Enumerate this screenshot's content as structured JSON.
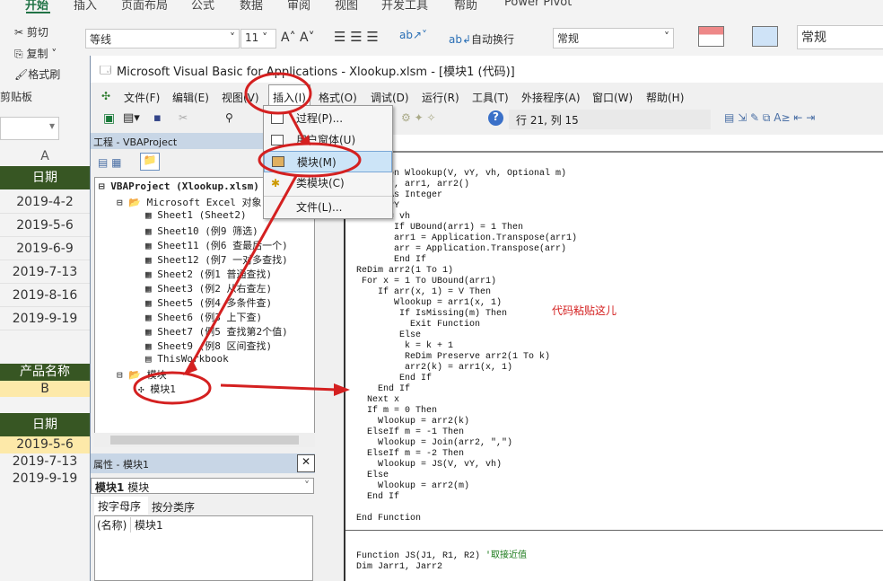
{
  "ribbon": {
    "tabs": [
      "开始",
      "插入",
      "页面布局",
      "公式",
      "数据",
      "审阅",
      "视图",
      "开发工具",
      "帮助",
      "Power Pivot"
    ],
    "cut": "剪切",
    "copy": "复制",
    "format_painter": "格式刷",
    "clipboard_group": "剪贴板",
    "font_name": "等线",
    "font_size": "11",
    "wrap_text": "自动换行",
    "number_format": "常规",
    "style_box": "常规"
  },
  "sheet": {
    "col": "A",
    "header1": "日期",
    "dates1": [
      "2019-4-2",
      "2019-5-6",
      "2019-6-9",
      "2019-7-13",
      "2019-8-16",
      "2019-9-19"
    ],
    "header2": "产品名称",
    "product": "B",
    "header3": "日期",
    "dates2": [
      "2019-5-6",
      "2019-7-13",
      "2019-9-19"
    ]
  },
  "vba": {
    "title": "Microsoft Visual Basic for Applications - Xlookup.xlsm - [模块1 (代码)]",
    "menu": [
      "文件(F)",
      "编辑(E)",
      "视图(V)",
      "插入(I)",
      "格式(O)",
      "调试(D)",
      "运行(R)",
      "工具(T)",
      "外接程序(A)",
      "窗口(W)",
      "帮助(H)"
    ],
    "position": "行 21, 列 15",
    "project_title": "工程 - VBAProject",
    "tree": [
      "VBAProject (Xlookup.xlsm)",
      "Microsoft Excel 对象",
      "Sheet1 (Sheet2)",
      "Sheet10 (例9 筛选)",
      "Sheet11 (例6 查最后一个)",
      "Sheet12 (例7 一对多查找)",
      "Sheet2 (例1 普通查找)",
      "Sheet3 (例2 从右查左)",
      "Sheet5 (例4 多条件查)",
      "Sheet6 (例3 上下查)",
      "Sheet7 (例5 查找第2个值)",
      "Sheet9 (例8 区间查找)",
      "ThisWorkbook",
      "模块",
      "模块1"
    ],
    "props_title": "属性 - 模块1",
    "props_object": "模块1",
    "props_type": "模块",
    "props_tabs": [
      "按字母序",
      "按分类序"
    ],
    "prop_name": "(名称)",
    "prop_value": "模块1",
    "insert_menu": [
      "过程(P)...",
      "用户窗体(U)",
      "模块(M)",
      "类模块(C)",
      "文件(L)..."
    ],
    "code": [
      "Function Wlookup(V, vY, vh, Optional m)",
      "Dim arr, arr1, arr2()",
      "Dim x As Integer",
      "arr = vY",
      " arr1 = vh",
      "       If UBound(arr1) = 1 Then",
      "       arr1 = Application.Transpose(arr1)",
      "       arr = Application.Transpose(arr)",
      "       End If",
      "ReDim arr2(1 To 1)",
      " For x = 1 To UBound(arr1)",
      "    If arr(x, 1) = V Then",
      "       Wlookup = arr1(x, 1)",
      "        If IsMissing(m) Then",
      "          Exit Function",
      "        Else",
      "         k = k + 1",
      "         ReDim Preserve arr2(1 To k)",
      "         arr2(k) = arr1(x, 1)",
      "        End If",
      "    End If",
      "  Next x",
      "  If m = 0 Then",
      "    Wlookup = arr2(k)",
      "  ElseIf m = -1 Then",
      "    Wlookup = Join(arr2, \",\")",
      "  ElseIf m = -2 Then",
      "    Wlookup = JS(V, vY, vh)",
      "  Else",
      "    Wlookup = arr2(m)",
      "  End If",
      "",
      "End Function"
    ],
    "code2": [
      "Function JS(J1, R1, R2) ",
      "Dim Jarr1, Jarr2"
    ],
    "code2_comment": "'取接近值",
    "annotation": "代码粘贴这儿"
  },
  "colors": {
    "annotation": "#d42020",
    "header_green": "#375623",
    "highlight": "#fde9a9",
    "menu_selected": "#cce4f7"
  }
}
